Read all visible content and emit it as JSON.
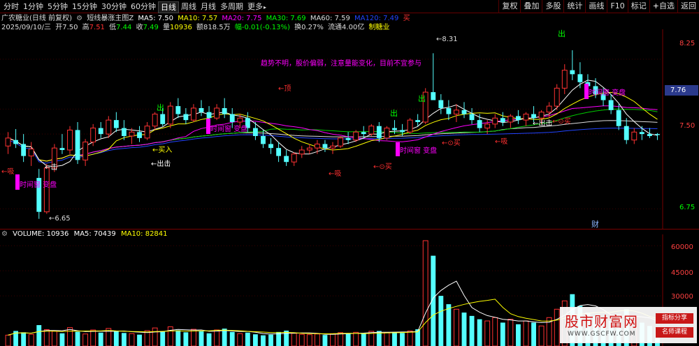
{
  "toolbar": {
    "tabs": [
      "分时",
      "1分钟",
      "5分钟",
      "15分钟",
      "30分钟",
      "60分钟",
      "日线",
      "周线",
      "月线",
      "多周期",
      "更多"
    ],
    "active_tab": "日线",
    "right_buttons": [
      "复权",
      "叠加",
      "多股",
      "统计",
      "画线",
      "F10",
      "标记",
      "自选",
      "返回"
    ]
  },
  "header": {
    "title": "广农糖业(日线 前复权)",
    "indicator": "短线暴涨主图Z",
    "ma5": "MA5: 7.50",
    "ma10": "MA10: 7.57",
    "ma20": "MA20: 7.75",
    "ma30": "MA30: 7.69",
    "ma60": "MA60: 7.59",
    "ma120": "MA120: 7.49",
    "buy": "买"
  },
  "quote": {
    "date": "2025/09/10/三",
    "open_label": "开",
    "open": "7.50",
    "high_label": "高",
    "high": "7.51",
    "low_label": "低",
    "low": "7.44",
    "close_label": "收",
    "close": "7.49",
    "vol_label": "量",
    "vol": "10936",
    "amount": "额818.5万",
    "change": "幅-0.01(-0.13%)",
    "turnover": "换0.27%",
    "float": "流通4.00亿",
    "sector": "制糖业"
  },
  "chart": {
    "price_axis": [
      "8.25",
      "7.75",
      "7.50",
      "6.75"
    ],
    "current_price": "7.76",
    "high_mark": "8.31",
    "low_mark": "6.65",
    "advice": "趋势不明，股价偏弱，注意量能变化，目前不宜参与",
    "signals": {
      "chu": "出",
      "xi": "吸",
      "ding": "顶",
      "mairu": "买入",
      "chuji": "出击",
      "mai": "买",
      "cai": "财",
      "shijianchuang": "时间窗 变盘",
      "ji": "击"
    }
  },
  "volume": {
    "label": "VOLUME: 10936",
    "ma5": "MA5: 70439",
    "ma10": "MA10: 82841",
    "axis": [
      "60000",
      "45000",
      "30000"
    ]
  },
  "watermark": {
    "title": "股市财富网",
    "url": "WWW.GSCFW.COM",
    "tag1": "指标分享",
    "tag2": "名师课程"
  },
  "chart_data": {
    "type": "candlestick",
    "price_range": [
      6.55,
      8.55
    ],
    "volume_max": 63000,
    "candles": [
      [
        7.38,
        7.52,
        7.3,
        7.46
      ],
      [
        7.44,
        7.55,
        7.36,
        7.4
      ],
      [
        7.4,
        7.5,
        7.22,
        7.28
      ],
      [
        7.28,
        7.42,
        7.18,
        7.35
      ],
      [
        7.06,
        7.15,
        6.65,
        6.72
      ],
      [
        6.72,
        7.2,
        6.7,
        7.16
      ],
      [
        7.16,
        7.4,
        7.12,
        7.36
      ],
      [
        7.36,
        7.5,
        7.3,
        7.34
      ],
      [
        7.34,
        7.58,
        7.3,
        7.54
      ],
      [
        7.54,
        7.62,
        7.2,
        7.24
      ],
      [
        7.24,
        7.45,
        7.18,
        7.42
      ],
      [
        7.42,
        7.6,
        7.38,
        7.56
      ],
      [
        7.56,
        7.62,
        7.46,
        7.5
      ],
      [
        7.5,
        7.68,
        7.46,
        7.64
      ],
      [
        7.64,
        7.72,
        7.52,
        7.56
      ],
      [
        7.56,
        7.64,
        7.44,
        7.48
      ],
      [
        7.48,
        7.56,
        7.4,
        7.52
      ],
      [
        7.52,
        7.58,
        7.42,
        7.46
      ],
      [
        7.46,
        7.62,
        7.44,
        7.58
      ],
      [
        7.58,
        7.72,
        7.54,
        7.7
      ],
      [
        7.7,
        7.76,
        7.58,
        7.6
      ],
      [
        7.6,
        7.82,
        7.56,
        7.78
      ],
      [
        7.78,
        7.86,
        7.66,
        7.7
      ],
      [
        7.7,
        7.76,
        7.6,
        7.64
      ],
      [
        7.64,
        7.8,
        7.62,
        7.76
      ],
      [
        7.76,
        7.84,
        7.68,
        7.72
      ],
      [
        7.72,
        7.78,
        7.62,
        7.66
      ],
      [
        7.66,
        7.8,
        7.64,
        7.76
      ],
      [
        7.76,
        7.86,
        7.66,
        7.7
      ],
      [
        7.7,
        7.76,
        7.56,
        7.62
      ],
      [
        7.62,
        7.7,
        7.56,
        7.66
      ],
      [
        7.66,
        7.72,
        7.52,
        7.56
      ],
      [
        7.56,
        7.62,
        7.44,
        7.48
      ],
      [
        7.48,
        7.54,
        7.36,
        7.4
      ],
      [
        7.4,
        7.46,
        7.3,
        7.36
      ],
      [
        7.36,
        7.42,
        7.22,
        7.28
      ],
      [
        7.28,
        7.34,
        7.18,
        7.22
      ],
      [
        7.22,
        7.32,
        7.18,
        7.3
      ],
      [
        7.3,
        7.38,
        7.26,
        7.34
      ],
      [
        7.34,
        7.4,
        7.3,
        7.36
      ],
      [
        7.36,
        7.44,
        7.3,
        7.4
      ],
      [
        7.4,
        7.44,
        7.32,
        7.36
      ],
      [
        7.36,
        7.42,
        7.3,
        7.38
      ],
      [
        7.38,
        7.48,
        7.36,
        7.46
      ],
      [
        7.46,
        7.52,
        7.4,
        7.44
      ],
      [
        7.44,
        7.54,
        7.42,
        7.52
      ],
      [
        7.52,
        7.58,
        7.46,
        7.5
      ],
      [
        7.5,
        7.6,
        7.48,
        7.58
      ],
      [
        7.58,
        7.62,
        7.42,
        7.46
      ],
      [
        7.46,
        7.58,
        7.44,
        7.56
      ],
      [
        7.56,
        7.64,
        7.5,
        7.54
      ],
      [
        7.54,
        7.6,
        7.48,
        7.52
      ],
      [
        7.52,
        7.66,
        7.5,
        7.64
      ],
      [
        7.64,
        7.7,
        7.58,
        7.62
      ],
      [
        7.62,
        7.96,
        7.6,
        7.92
      ],
      [
        7.92,
        8.31,
        7.88,
        7.84
      ],
      [
        7.84,
        7.9,
        7.7,
        7.76
      ],
      [
        7.76,
        7.84,
        7.64,
        7.7
      ],
      [
        7.7,
        7.8,
        7.62,
        7.74
      ],
      [
        7.74,
        7.82,
        7.66,
        7.7
      ],
      [
        7.7,
        7.76,
        7.6,
        7.64
      ],
      [
        7.64,
        7.7,
        7.52,
        7.56
      ],
      [
        7.56,
        7.64,
        7.5,
        7.6
      ],
      [
        7.6,
        7.7,
        7.56,
        7.66
      ],
      [
        7.66,
        7.72,
        7.58,
        7.62
      ],
      [
        7.62,
        7.7,
        7.56,
        7.68
      ],
      [
        7.68,
        7.74,
        7.6,
        7.64
      ],
      [
        7.64,
        7.72,
        7.58,
        7.7
      ],
      [
        7.7,
        7.78,
        7.62,
        7.66
      ],
      [
        7.66,
        7.74,
        7.6,
        7.72
      ],
      [
        7.72,
        7.82,
        7.66,
        7.78
      ],
      [
        7.78,
        8.0,
        7.74,
        7.96
      ],
      [
        7.96,
        8.2,
        7.9,
        8.14
      ],
      [
        8.14,
        8.34,
        8.04,
        8.1
      ],
      [
        8.1,
        8.22,
        7.96,
        8.02
      ],
      [
        8.02,
        8.1,
        7.92,
        7.98
      ],
      [
        7.98,
        8.06,
        7.86,
        7.9
      ],
      [
        7.9,
        7.96,
        7.78,
        7.84
      ],
      [
        7.84,
        7.9,
        7.7,
        7.74
      ],
      [
        7.74,
        7.8,
        7.54,
        7.58
      ],
      [
        7.58,
        7.66,
        7.4,
        7.44
      ],
      [
        7.44,
        7.56,
        7.4,
        7.52
      ],
      [
        7.52,
        7.58,
        7.44,
        7.5
      ],
      [
        7.5,
        7.56,
        7.46,
        7.48
      ],
      [
        7.5,
        7.51,
        7.44,
        7.49
      ]
    ],
    "volumes": [
      6500,
      9000,
      8200,
      7000,
      12500,
      9800,
      8800,
      7600,
      11000,
      8500,
      7200,
      9600,
      8000,
      10500,
      9000,
      7800,
      7400,
      6800,
      9200,
      10800,
      8600,
      11500,
      9400,
      8200,
      10000,
      8800,
      7600,
      9600,
      10400,
      8400,
      7400,
      8000,
      7000,
      6400,
      6800,
      8400,
      9200,
      7600,
      7000,
      6800,
      7200,
      6600,
      7400,
      8000,
      7600,
      8200,
      7400,
      8800,
      9000,
      8000,
      8400,
      7800,
      9000,
      10000,
      63000,
      54000,
      30000,
      25000,
      22000,
      20000,
      18000,
      16000,
      15000,
      17000,
      14000,
      16000,
      13000,
      15000,
      14000,
      12000,
      17000,
      22000,
      27000,
      31000,
      24000,
      20000,
      18000,
      16000,
      15000,
      19000,
      22000,
      17000,
      14000,
      12000,
      10936
    ]
  }
}
